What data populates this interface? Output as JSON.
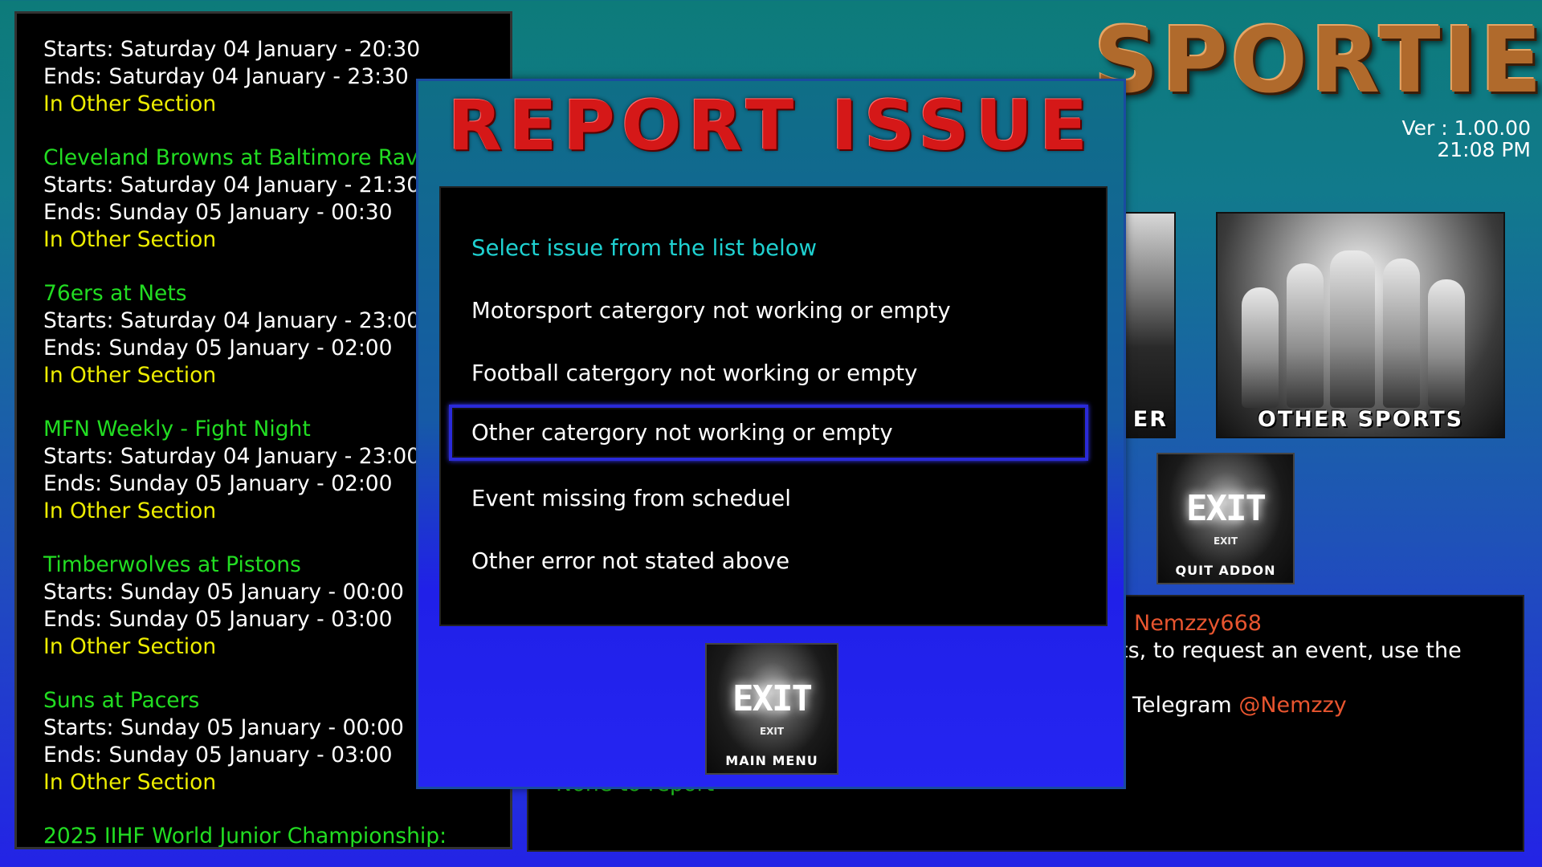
{
  "schedule": {
    "events": [
      {
        "title": "",
        "starts": "Starts: Saturday 04 January - 20:30",
        "ends": "Ends: Saturday 04 January - 23:30",
        "section": "In Other Section"
      },
      {
        "title": "Cleveland Browns at Baltimore Ravens",
        "starts": "Starts: Saturday 04 January - 21:30",
        "ends": "Ends: Sunday 05 January - 00:30",
        "section": "In Other Section"
      },
      {
        "title": "76ers at Nets",
        "starts": "Starts: Saturday 04 January - 23:00",
        "ends": "Ends: Sunday 05 January - 02:00",
        "section": "In Other Section"
      },
      {
        "title": "MFN Weekly - Fight Night",
        "starts": "Starts: Saturday 04 January - 23:00",
        "ends": "Ends: Sunday 05 January - 02:00",
        "section": "In Other Section"
      },
      {
        "title": "Timberwolves at Pistons",
        "starts": "Starts: Sunday 05 January - 00:00",
        "ends": "Ends: Sunday 05 January - 03:00",
        "section": "In Other Section"
      },
      {
        "title": "Suns at Pacers",
        "starts": "Starts: Sunday 05 January - 00:00",
        "ends": "Ends: Sunday 05 January - 03:00",
        "section": "In Other Section"
      },
      {
        "title": "2025 IIHF World Junior Championship:",
        "starts": "",
        "ends": "",
        "section": ""
      }
    ]
  },
  "logo": {
    "text": "SPORTIE"
  },
  "version": {
    "ver": "Ver : 1.00.00",
    "time": "21:08 PM"
  },
  "tiles": {
    "partial_label": "ER",
    "other_sports_label": "OTHER SPORTS",
    "quit": {
      "sign": "EXIT",
      "small": "EXIT",
      "label": "QUIT ADDON"
    }
  },
  "info": {
    "author": "Nemzzy668",
    "line2": "ts, to request an event, use the",
    "telegram_prefix": "Telegram",
    "telegram_handle": "@Nemzzy",
    "none_report": "None to report"
  },
  "dialog": {
    "title": "REPORT ISSUE",
    "header": "Select issue from the list below",
    "items": [
      "Motorsport catergory not working or empty",
      "Football catergory not working or empty",
      "Other catergory not working or empty",
      "Event missing from scheduel",
      "Other error not stated above"
    ],
    "selected_index": 2,
    "main_menu": {
      "sign": "EXIT",
      "small": "EXIT",
      "label": "MAIN MENU"
    }
  },
  "colors": {
    "title_red": "#d51818",
    "event_title_green": "#22dd22",
    "section_yellow": "#eded00",
    "header_cyan": "#1fd1d1",
    "accent_orange": "#e8552f",
    "selection_blue": "#2a2ad8"
  }
}
